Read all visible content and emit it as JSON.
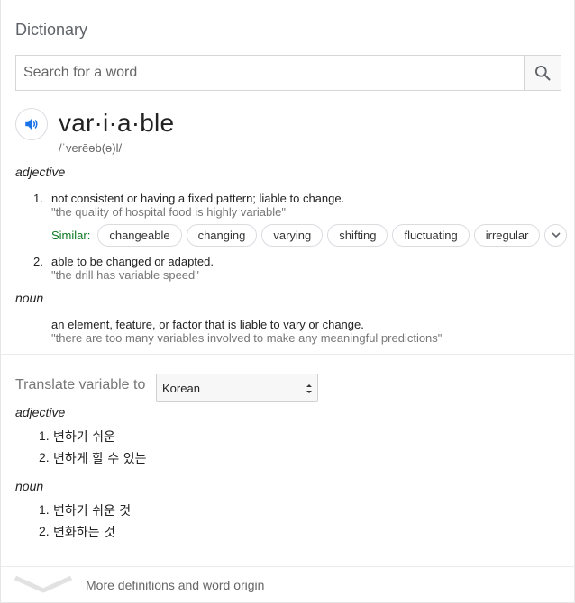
{
  "header": {
    "title": "Dictionary"
  },
  "search": {
    "placeholder": "Search for a word",
    "icon": "search-icon"
  },
  "entry": {
    "word": "var·i·a·ble",
    "phonetic": "/ˈverēəb(ə)l/",
    "speaker_icon": "speaker-icon"
  },
  "adjective": {
    "label": "adjective",
    "senses": [
      {
        "num": "1.",
        "definition": "not consistent or having a fixed pattern; liable to change.",
        "example": "\"the quality of hospital food is highly variable\""
      },
      {
        "num": "2.",
        "definition": "able to be changed or adapted.",
        "example": "\"the drill has variable speed\""
      }
    ],
    "similar_label": "Similar:",
    "similar": [
      "changeable",
      "changing",
      "varying",
      "shifting",
      "fluctuating",
      "irregular"
    ]
  },
  "noun": {
    "label": "noun",
    "definition": "an element, feature, or factor that is liable to vary or change.",
    "example": "\"there are too many variables involved to make any meaningful predictions\""
  },
  "translate": {
    "label": "Translate variable to",
    "selected_language": "Korean",
    "adjective_label": "adjective",
    "adjective_items": [
      {
        "num": "1.",
        "text": "변하기 쉬운"
      },
      {
        "num": "2.",
        "text": "변하게 할 수 있는"
      }
    ],
    "noun_label": "noun",
    "noun_items": [
      {
        "num": "1.",
        "text": "변하기 쉬운 것"
      },
      {
        "num": "2.",
        "text": "변화하는 것"
      }
    ]
  },
  "footer": {
    "more_label": "More definitions and word origin"
  },
  "colors": {
    "accent": "#1a73e8",
    "similar_label": "#0d7a25",
    "example_text": "#777777"
  }
}
